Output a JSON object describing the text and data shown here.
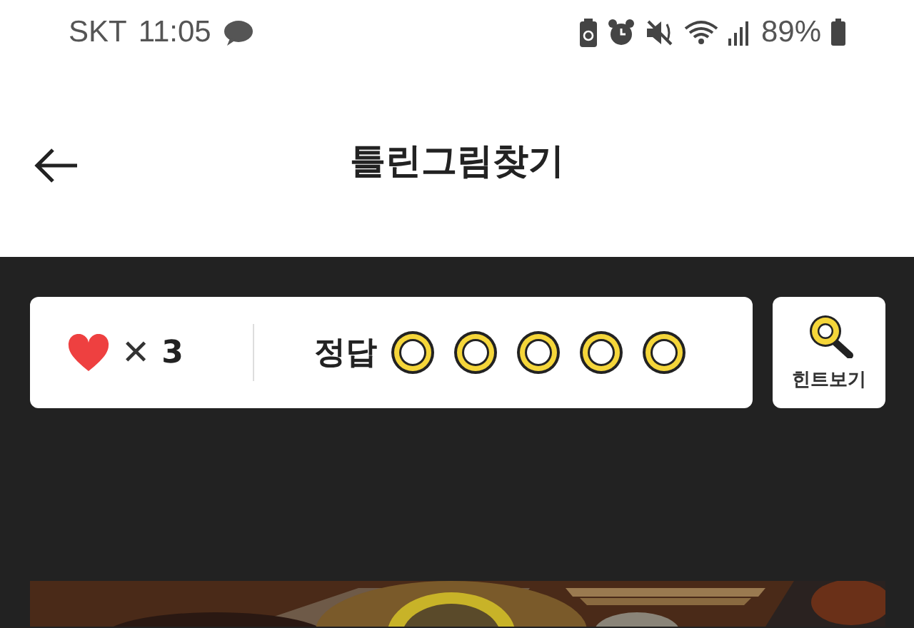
{
  "status_bar": {
    "carrier": "SKT",
    "time": "11:05",
    "battery": "89%"
  },
  "header": {
    "title": "틀린그림찾기"
  },
  "score": {
    "lives_sign": "✕",
    "lives": "3",
    "answer_label": "정답",
    "answers": [
      {
        "found": false
      },
      {
        "found": false
      },
      {
        "found": false
      },
      {
        "found": false
      },
      {
        "found": false
      }
    ]
  },
  "hint_button": {
    "label": "힌트보기"
  }
}
